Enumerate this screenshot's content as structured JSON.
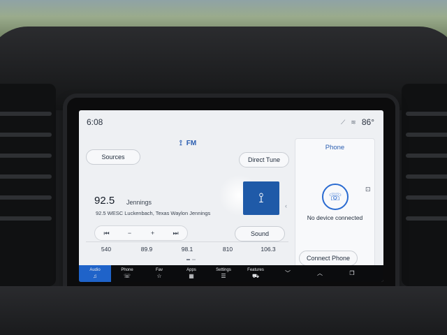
{
  "status": {
    "time": "6:08",
    "temperature": "86°"
  },
  "radio": {
    "band": "FM",
    "sources_label": "Sources",
    "direct_tune_label": "Direct Tune",
    "sound_label": "Sound",
    "frequency": "92.5",
    "station": "Jennings",
    "rds_text": "92.5 WESC Luckenbach, Texas Waylon Jennings",
    "transport": [
      "⏮",
      "−",
      "+",
      "⏭"
    ],
    "presets": [
      "540",
      "89.9",
      "98.1",
      "810",
      "106.3"
    ]
  },
  "phone": {
    "title": "Phone",
    "status": "No device connected",
    "connect_label": "Connect Phone"
  },
  "nav": [
    {
      "label": "Audio",
      "icon": "♫",
      "active": true
    },
    {
      "label": "Phone",
      "icon": "☏",
      "active": false
    },
    {
      "label": "Fav",
      "icon": "☆",
      "active": false
    },
    {
      "label": "Apps",
      "icon": "▦",
      "active": false
    },
    {
      "label": "Settings",
      "icon": "☰",
      "active": false
    },
    {
      "label": "Features",
      "icon": "⛟",
      "active": false
    },
    {
      "label": "",
      "icon": "﹀",
      "active": false
    },
    {
      "label": "",
      "icon": "︿",
      "active": false
    },
    {
      "label": "",
      "icon": "❐",
      "active": false
    }
  ]
}
